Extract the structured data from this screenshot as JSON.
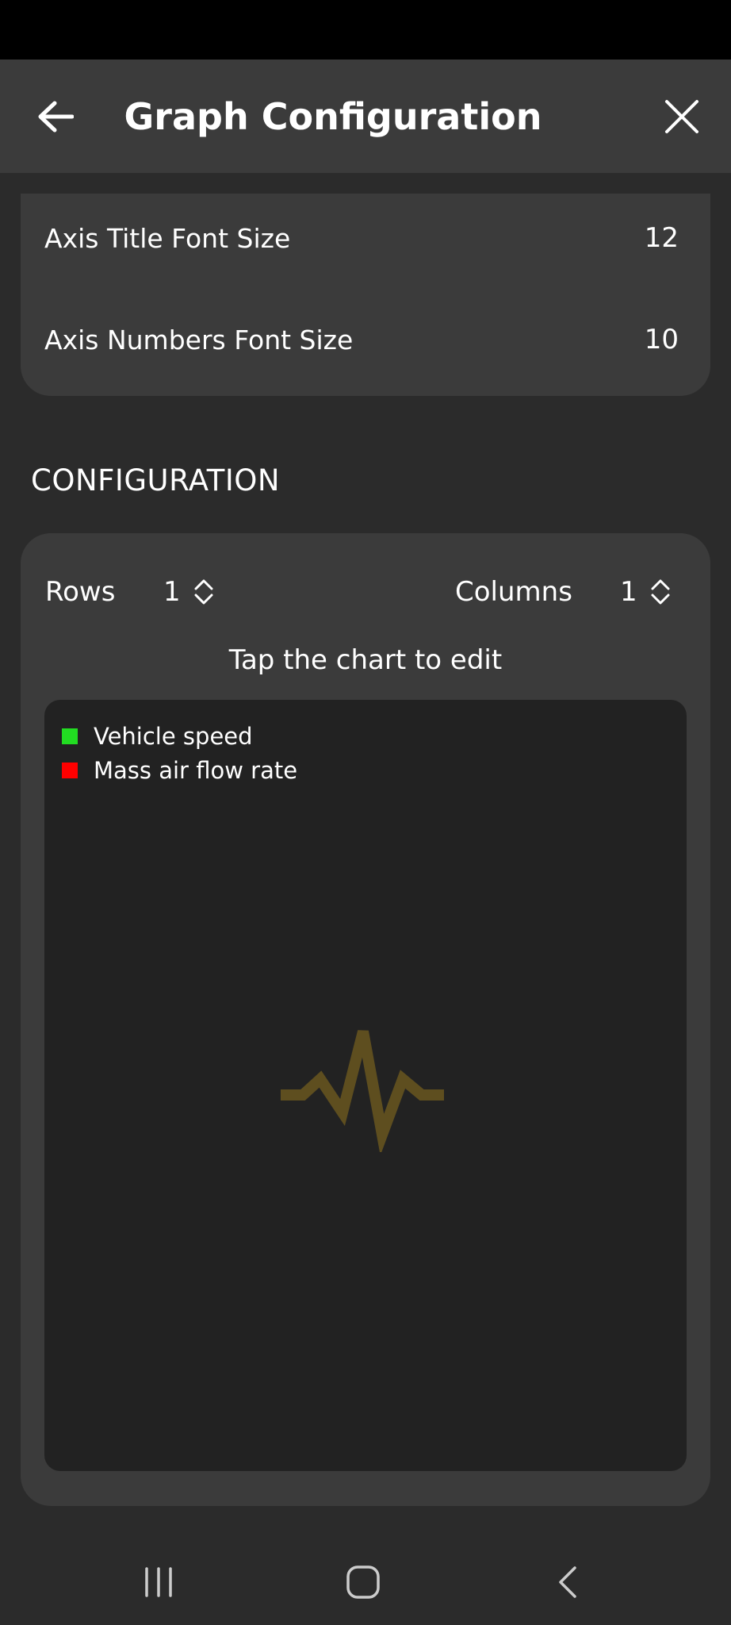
{
  "header": {
    "title": "Graph Configuration",
    "back_icon": "arrow-left-icon",
    "close_icon": "close-icon"
  },
  "font_settings": {
    "rows": [
      {
        "label": "Axis Title Font Size",
        "value": "12"
      },
      {
        "label": "Axis Numbers Font Size",
        "value": "10"
      }
    ]
  },
  "configuration": {
    "section_title": "CONFIGURATION",
    "rows_label": "Rows",
    "rows_value": "1",
    "columns_label": "Columns",
    "columns_value": "1",
    "hint": "Tap the chart to edit",
    "legend": [
      {
        "label": "Vehicle speed",
        "color": "#22dd22"
      },
      {
        "label": "Mass air flow rate",
        "color": "#ff0000"
      }
    ],
    "placeholder_icon": "pulse-icon",
    "placeholder_color": "#5e4e1f"
  },
  "navigation": {
    "recent_icon": "recent-apps-icon",
    "home_icon": "home-icon",
    "back_icon": "back-chevron-icon"
  }
}
